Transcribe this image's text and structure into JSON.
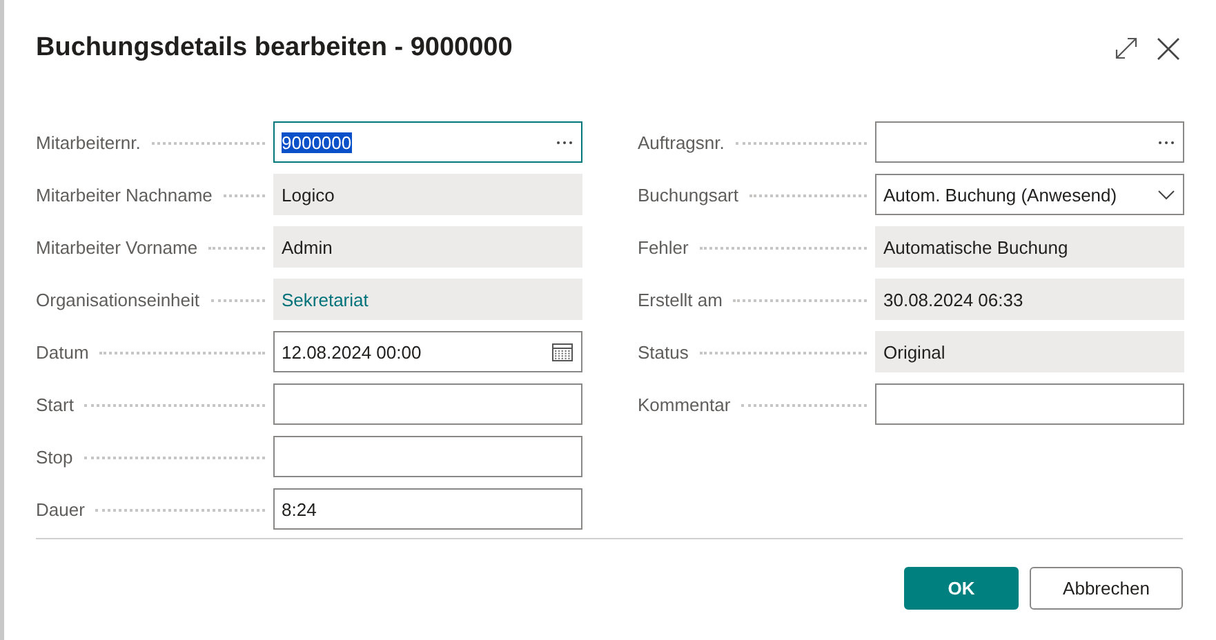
{
  "dialog": {
    "title": "Buchungsdetails bearbeiten - 9000000"
  },
  "columns": [
    [
      {
        "label": "Mitarbeiternr.",
        "kind": "lookup",
        "value": "9000000",
        "focused": true,
        "link": false
      },
      {
        "label": "Mitarbeiter Nachname",
        "kind": "readonly",
        "value": "Logico",
        "focused": false,
        "link": false
      },
      {
        "label": "Mitarbeiter Vorname",
        "kind": "readonly",
        "value": "Admin",
        "focused": false,
        "link": false
      },
      {
        "label": "Organisationseinheit",
        "kind": "readonly",
        "value": "Sekretariat",
        "focused": false,
        "link": true
      },
      {
        "label": "Datum",
        "kind": "date",
        "value": "12.08.2024 00:00",
        "focused": false,
        "link": false
      },
      {
        "label": "Start",
        "kind": "text",
        "focused": false
      },
      {
        "label": "Stop",
        "kind": "text",
        "focused": false
      },
      {
        "label": "Dauer",
        "kind": "text",
        "value": "8:24",
        "focused": false,
        "link": false
      }
    ],
    [
      {
        "label": "Auftragsnr.",
        "kind": "lookup",
        "focused": false
      },
      {
        "label": "Buchungsart",
        "kind": "select",
        "value": "Autom. Buchung (Anwesend)",
        "focused": false,
        "link": false
      },
      {
        "label": "Fehler",
        "kind": "readonly",
        "value": "Automatische Buchung",
        "focused": false,
        "link": false
      },
      {
        "label": "Erstellt am",
        "kind": "readonly",
        "value": "30.08.2024 06:33",
        "focused": false,
        "link": false
      },
      {
        "label": "Status",
        "kind": "readonly",
        "value": "Original",
        "focused": false,
        "link": false
      },
      {
        "label": "Kommentar",
        "kind": "text",
        "focused": false
      }
    ]
  ],
  "buttons": [
    {
      "label": "OK",
      "kind": "primary"
    },
    {
      "label": "Abbrechen",
      "kind": "secondary"
    }
  ]
}
